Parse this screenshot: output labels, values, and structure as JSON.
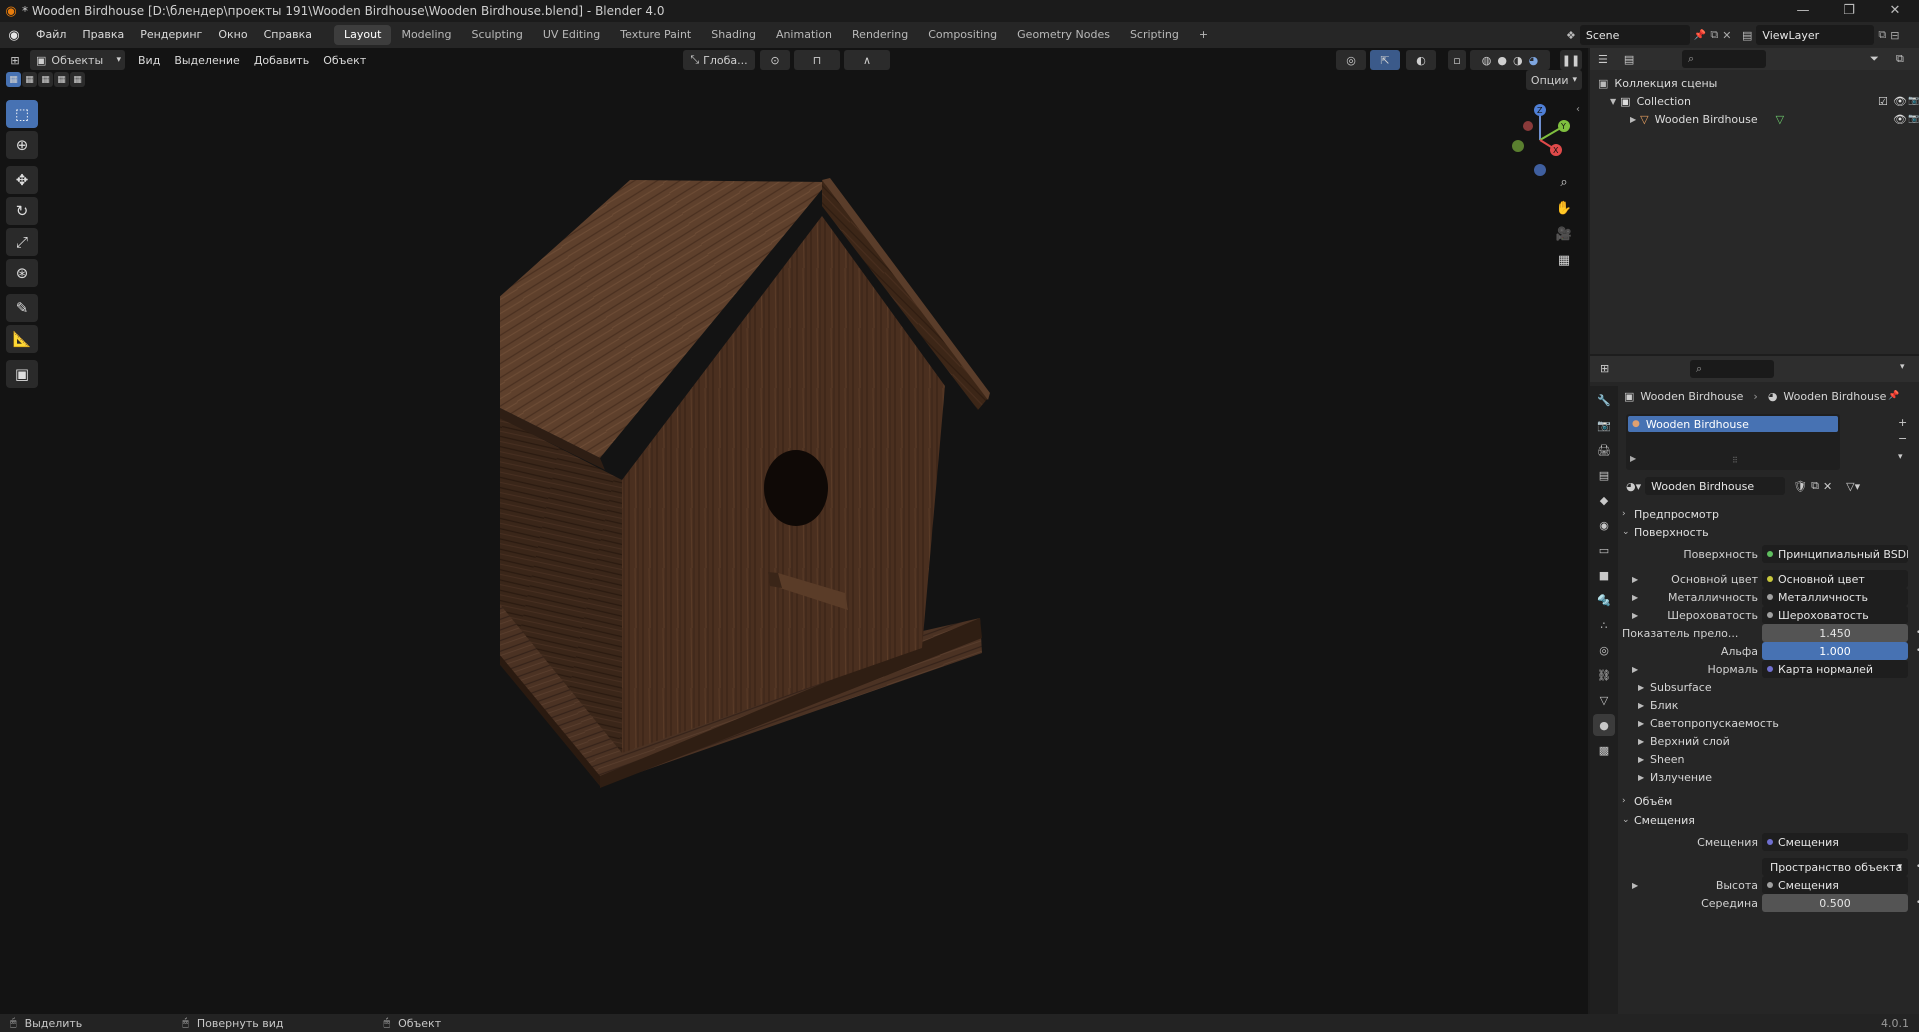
{
  "window": {
    "title": "* Wooden Birdhouse [D:\\блендер\\проекты 191\\Wooden Birdhouse\\Wooden Birdhouse.blend] - Blender 4.0"
  },
  "menus": [
    "Файл",
    "Правка",
    "Рендеринг",
    "Окно",
    "Справка"
  ],
  "workspaces": [
    "Layout",
    "Modeling",
    "Sculpting",
    "UV Editing",
    "Texture Paint",
    "Shading",
    "Animation",
    "Rendering",
    "Compositing",
    "Geometry Nodes",
    "Scripting"
  ],
  "active_workspace": "Layout",
  "scene": {
    "name": "Scene",
    "view_layer": "ViewLayer"
  },
  "viewport": {
    "mode": "Объекты",
    "menu": [
      "Вид",
      "Выделение",
      "Добавить",
      "Объект"
    ],
    "transform_orientation": "Глоба...",
    "options_label": "Опции"
  },
  "outliner": {
    "root": "Коллекция сцены",
    "collection": "Collection",
    "object": "Wooden Birdhouse"
  },
  "properties": {
    "breadcrumb_object": "Wooden Birdhouse",
    "breadcrumb_material": "Wooden Birdhouse",
    "slot_name": "Wooden Birdhouse",
    "material_name": "Wooden Birdhouse",
    "sections": {
      "preview": "Предпросмотр",
      "surface": "Поверхность",
      "volume": "Объём",
      "displacement": "Смещения"
    },
    "surface": {
      "surface_label": "Поверхность",
      "surface_value": "Принципиальный BSDF",
      "base_color_label": "Основной цвет",
      "base_color_value": "Основной цвет",
      "metallic_label": "Металличность",
      "metallic_value": "Металличность",
      "roughness_label": "Шероховатость",
      "roughness_value": "Шероховатость",
      "ior_label": "Показатель прело...",
      "ior_value": "1.450",
      "alpha_label": "Альфа",
      "alpha_value": "1.000",
      "normal_label": "Нормаль",
      "normal_value": "Карта нормалей",
      "subsections": [
        "Subsurface",
        "Блик",
        "Светопропускаемость",
        "Верхний слой",
        "Sheen",
        "Излучение"
      ]
    },
    "displacement": {
      "disp_label": "Смещения",
      "disp_value": "Смещения",
      "space_value": "Пространство объекта",
      "height_label": "Высота",
      "height_value": "Смещения",
      "midlevel_label": "Середина",
      "midlevel_value": "0.500"
    }
  },
  "statusbar": {
    "select": "Выделить",
    "rotate": "Повернуть вид",
    "object": "Объект",
    "version": "4.0.1"
  },
  "colors": {
    "accent": "#4772b3",
    "wood_dark": "#3a2518",
    "wood_mid": "#5a3a26",
    "wood_light": "#7a5540"
  }
}
